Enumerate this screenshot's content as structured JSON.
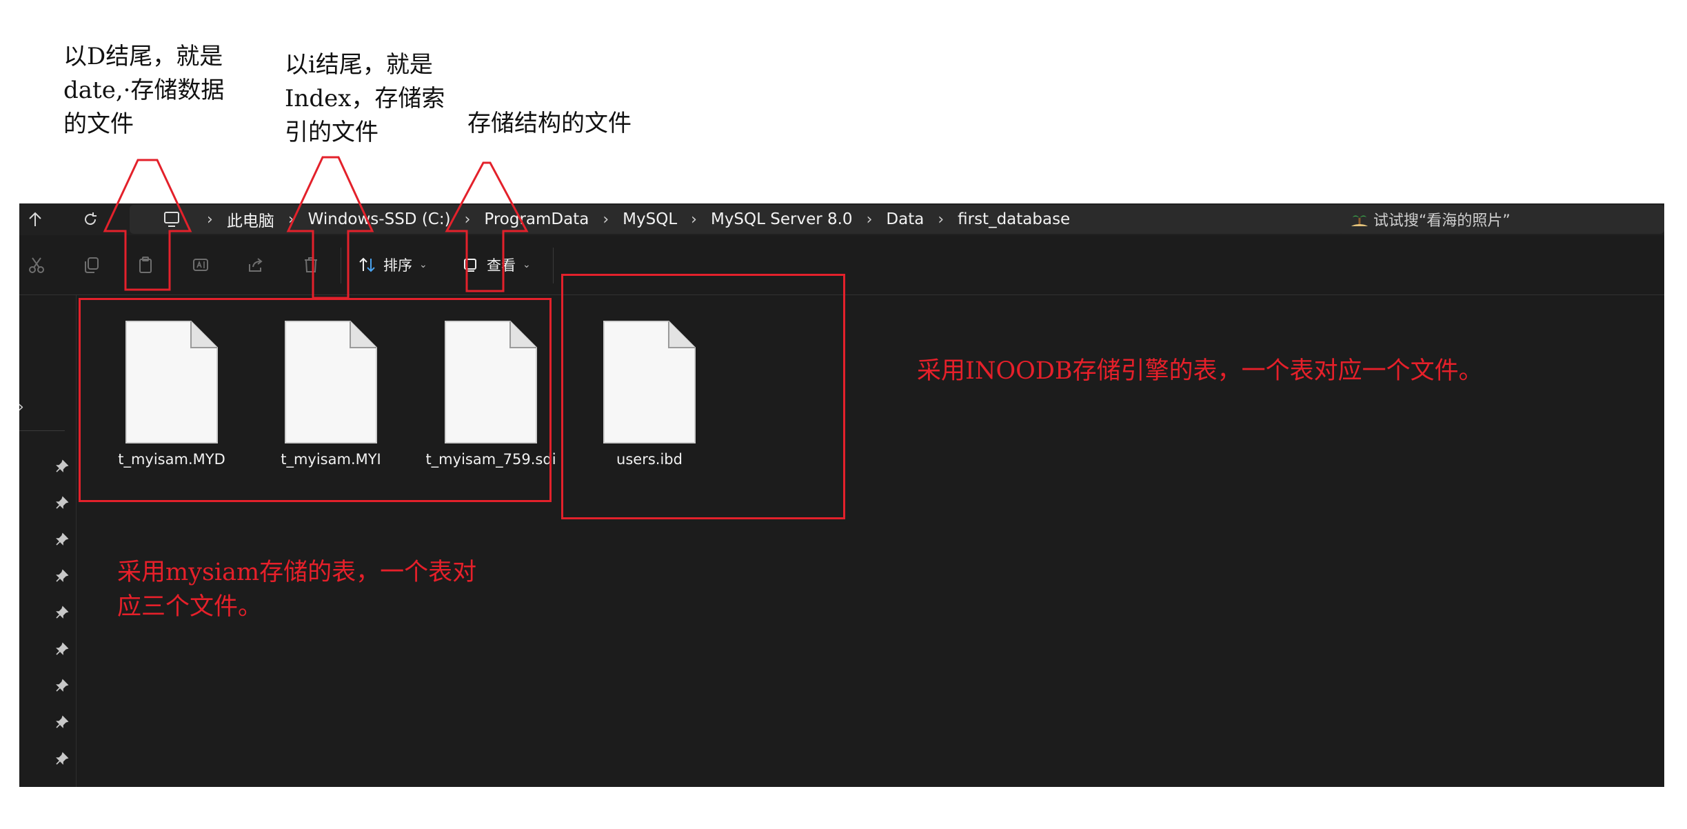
{
  "annotations": {
    "note_data_file": "以D结尾，就是\ndate,·存储数据\n的文件",
    "note_index_file": "以i结尾，就是\nIndex，存储索\n引的文件",
    "note_structure_file": "存储结构的文件",
    "note_myisam": "采用mysiam存储的表，一个表对\n应三个文件。",
    "note_innodb": "采用INOODB存储引擎的表，一个表对应一个文件。",
    "accent_color": "#e3212b"
  },
  "explorer": {
    "breadcrumbs": [
      "此电脑",
      "Windows-SSD (C:)",
      "ProgramData",
      "MySQL",
      "MySQL Server 8.0",
      "Data",
      "first_database"
    ],
    "search_placeholder": "试试搜“看海的照片”",
    "toolbar": {
      "sort_label": "排序",
      "view_label": "查看"
    },
    "files": [
      {
        "name": "t_myisam.MYD"
      },
      {
        "name": "t_myisam.MYI"
      },
      {
        "name": "t_myisam_759.sdi"
      },
      {
        "name": "users.ibd"
      }
    ],
    "sidebar_pins": 9
  }
}
